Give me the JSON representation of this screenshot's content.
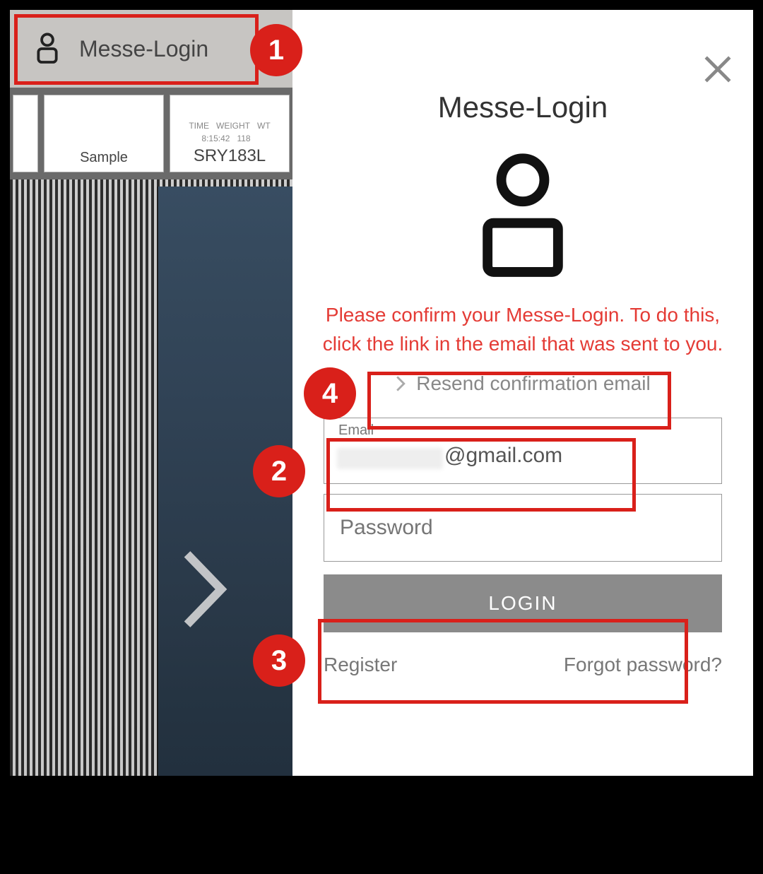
{
  "left": {
    "bar_label": "Messe-Login",
    "card_sample": "Sample",
    "card_code": "SRY183L",
    "card_cols": [
      "TIME",
      "WEIGHT",
      "WT"
    ],
    "card_vals": [
      "8:15:42",
      "118",
      ""
    ]
  },
  "login": {
    "title": "Messe-Login",
    "notice": "Please confirm your Messe-Login. To do this, click the link in the email that was sent to you.",
    "resend": "Resend confirmation email",
    "email_label": "Email",
    "email_value": "@gmail.com",
    "password_placeholder": "Password",
    "login_button": "LOGIN",
    "register": "Register",
    "forgot": "Forgot password?"
  },
  "callouts": {
    "n1": "1",
    "n2": "2",
    "n3": "3",
    "n4": "4"
  }
}
